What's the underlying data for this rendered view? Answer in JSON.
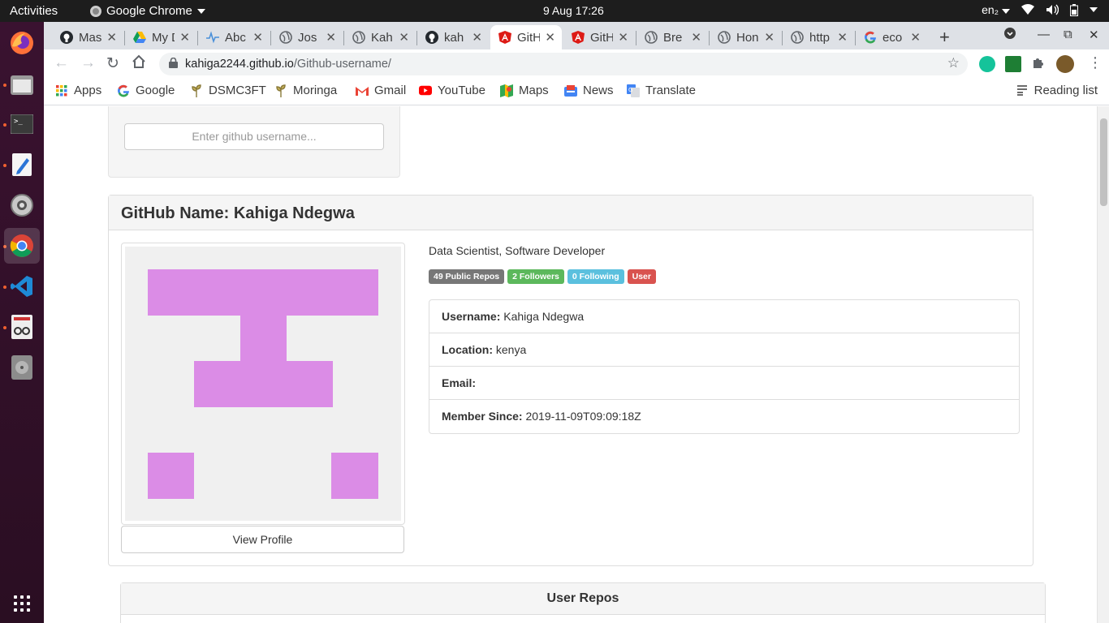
{
  "system": {
    "activities": "Activities",
    "app_name": "Google Chrome",
    "clock": "9 Aug  17:26",
    "keyboard": "en₂"
  },
  "tabs": [
    {
      "title": "Mas",
      "icon": "github-icon"
    },
    {
      "title": "My D",
      "icon": "drive-icon"
    },
    {
      "title": "Abc",
      "icon": "pulse-icon"
    },
    {
      "title": "Jos",
      "icon": "globe-icon"
    },
    {
      "title": "Kah",
      "icon": "globe-icon"
    },
    {
      "title": "kah",
      "icon": "github-icon"
    },
    {
      "title": "GitH",
      "icon": "angular-icon",
      "active": true
    },
    {
      "title": "GitH",
      "icon": "angular-icon"
    },
    {
      "title": "Bre",
      "icon": "globe-icon"
    },
    {
      "title": "Hon",
      "icon": "globe-icon"
    },
    {
      "title": "http",
      "icon": "globe-icon"
    },
    {
      "title": "eco",
      "icon": "google-icon"
    }
  ],
  "address": {
    "host": "kahiga2244.github.io",
    "path": "/Github-username/"
  },
  "bookmarks": [
    {
      "label": "Apps",
      "icon": "apps-grid-icon"
    },
    {
      "label": "Google",
      "icon": "google-icon"
    },
    {
      "label": "DSMC3FT",
      "icon": "sprout-icon"
    },
    {
      "label": "Moringa",
      "icon": "sprout-icon"
    },
    {
      "label": "Gmail",
      "icon": "gmail-icon"
    },
    {
      "label": "YouTube",
      "icon": "youtube-icon"
    },
    {
      "label": "Maps",
      "icon": "maps-icon"
    },
    {
      "label": "News",
      "icon": "news-icon"
    },
    {
      "label": "Translate",
      "icon": "translate-icon"
    }
  ],
  "reading_list": "Reading list",
  "page": {
    "search_placeholder": "Enter github username...",
    "profile_title": "GitHub Name: Kahiga Ndegwa",
    "bio": "Data Scientist, Software Developer",
    "badges": [
      {
        "label": "49 Public Repos",
        "color": "#777777"
      },
      {
        "label": "2 Followers",
        "color": "#5cb85c"
      },
      {
        "label": "0 Following",
        "color": "#5bc0de"
      },
      {
        "label": "User",
        "color": "#d9534f"
      }
    ],
    "details": [
      {
        "key": "Username:",
        "value": "Kahiga Ndegwa"
      },
      {
        "key": "Location:",
        "value": "kenya"
      },
      {
        "key": "Email:",
        "value": ""
      },
      {
        "key": "Member Since:",
        "value": "2019-11-09T09:09:18Z"
      }
    ],
    "view_profile": "View Profile",
    "repos_title": "User Repos"
  },
  "colors": {
    "identicon": "#db8ce6",
    "accent_angular": "#dd1b16"
  }
}
